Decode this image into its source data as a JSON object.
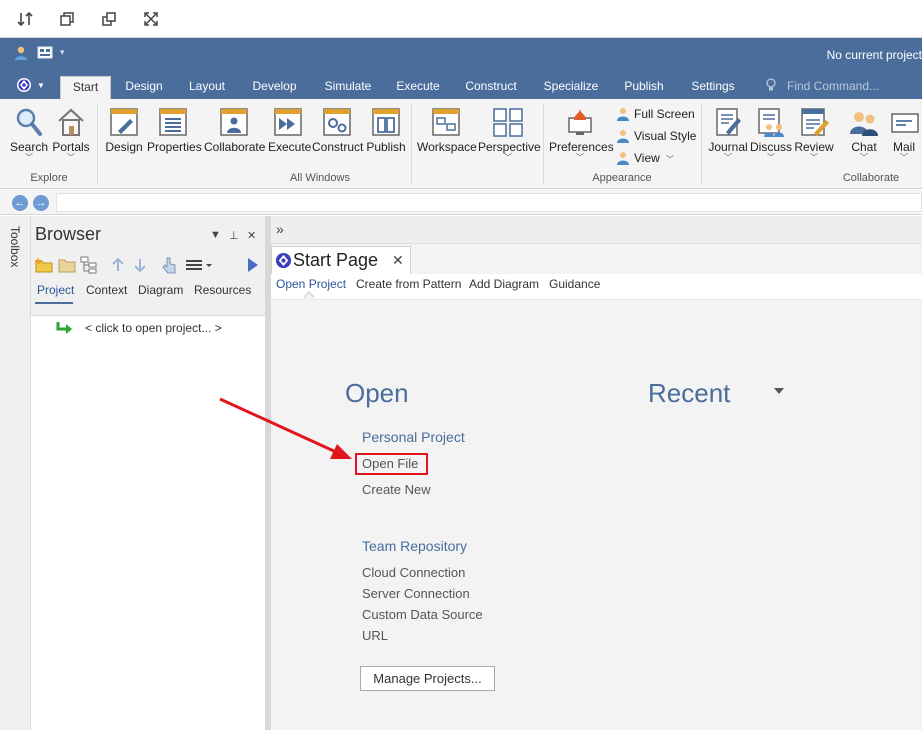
{
  "quick_access": {
    "icons": [
      "sort-arrows-icon",
      "restore-window-icon",
      "cascade-windows-icon",
      "fullscreen-icon"
    ]
  },
  "titlebar": {
    "title": "No current project"
  },
  "ribbon": {
    "tabs": [
      "Start",
      "Design",
      "Layout",
      "Develop",
      "Simulate",
      "Execute",
      "Construct",
      "Specialize",
      "Publish",
      "Settings"
    ],
    "active_tab": "Start",
    "find_command": "Find Command...",
    "explore": {
      "label": "Explore",
      "search": "Search",
      "portals": "Portals"
    },
    "all_windows": {
      "label": "All Windows",
      "design": "Design",
      "properties": "Properties",
      "collaborate": "Collaborate",
      "execute": "Execute",
      "construct": "Construct",
      "publish": "Publish",
      "workspace": "Workspace",
      "perspective": "Perspective"
    },
    "appearance": {
      "label": "Appearance",
      "preferences": "Preferences",
      "full_screen": "Full Screen",
      "visual_style": "Visual Style",
      "view": "View"
    },
    "collaborate": {
      "label": "Collaborate",
      "journal": "Journal",
      "discuss": "Discuss",
      "review": "Review",
      "chat": "Chat",
      "mail": "Mail"
    }
  },
  "navbar": {
    "back": "←",
    "forward": "→"
  },
  "toolbox": {
    "label": "Toolbox"
  },
  "browser": {
    "title": "Browser",
    "controls": {
      "dropdown": "▼",
      "pin": "⊥",
      "close": "✕"
    },
    "tabs": [
      "Project",
      "Context",
      "Diagram",
      "Resources"
    ],
    "active_tab": "Project",
    "tree_item": "< click to open project... >"
  },
  "main": {
    "expand": "»",
    "doc_tab": {
      "title": "Start Page",
      "close": "✕"
    },
    "subtabs": [
      "Open Project",
      "Create from Pattern",
      "Add Diagram",
      "Guidance"
    ],
    "active_subtab": "Open Project",
    "open": {
      "heading": "Open",
      "personal_project": "Personal Project",
      "open_file": "Open File",
      "create_new": "Create New",
      "team_repository": "Team Repository",
      "cloud_connection": "Cloud Connection",
      "server_connection": "Server Connection",
      "custom_data_source": "Custom Data Source",
      "url": "URL",
      "manage_projects": "Manage Projects..."
    },
    "recent": {
      "heading": "Recent"
    }
  },
  "colors": {
    "title_bar": "#4a6d9c",
    "accent_text": "#4a6d9c",
    "annotation_red": "#e0161c"
  }
}
